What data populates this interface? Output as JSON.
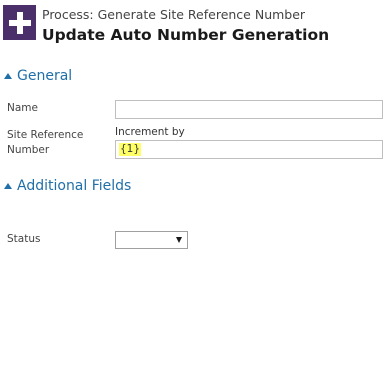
{
  "header": {
    "icon": "plus-icon",
    "icon_bg_color": "#4b2f6b",
    "process_line": "Process: Generate Site Reference Number",
    "title": "Update Auto Number Generation"
  },
  "sections": {
    "general": {
      "label": "General",
      "expanded": true,
      "fields": {
        "name": {
          "label": "Name",
          "value": ""
        },
        "site_reference_number": {
          "label": "Site Reference Number",
          "caption": "Increment by",
          "value": "{1}"
        }
      }
    },
    "additional_fields": {
      "label": "Additional Fields",
      "expanded": true,
      "fields": {
        "status": {
          "label": "Status",
          "value": ""
        }
      }
    }
  },
  "colors": {
    "section_header": "#1f6fa8",
    "highlight": "#ffff66"
  }
}
